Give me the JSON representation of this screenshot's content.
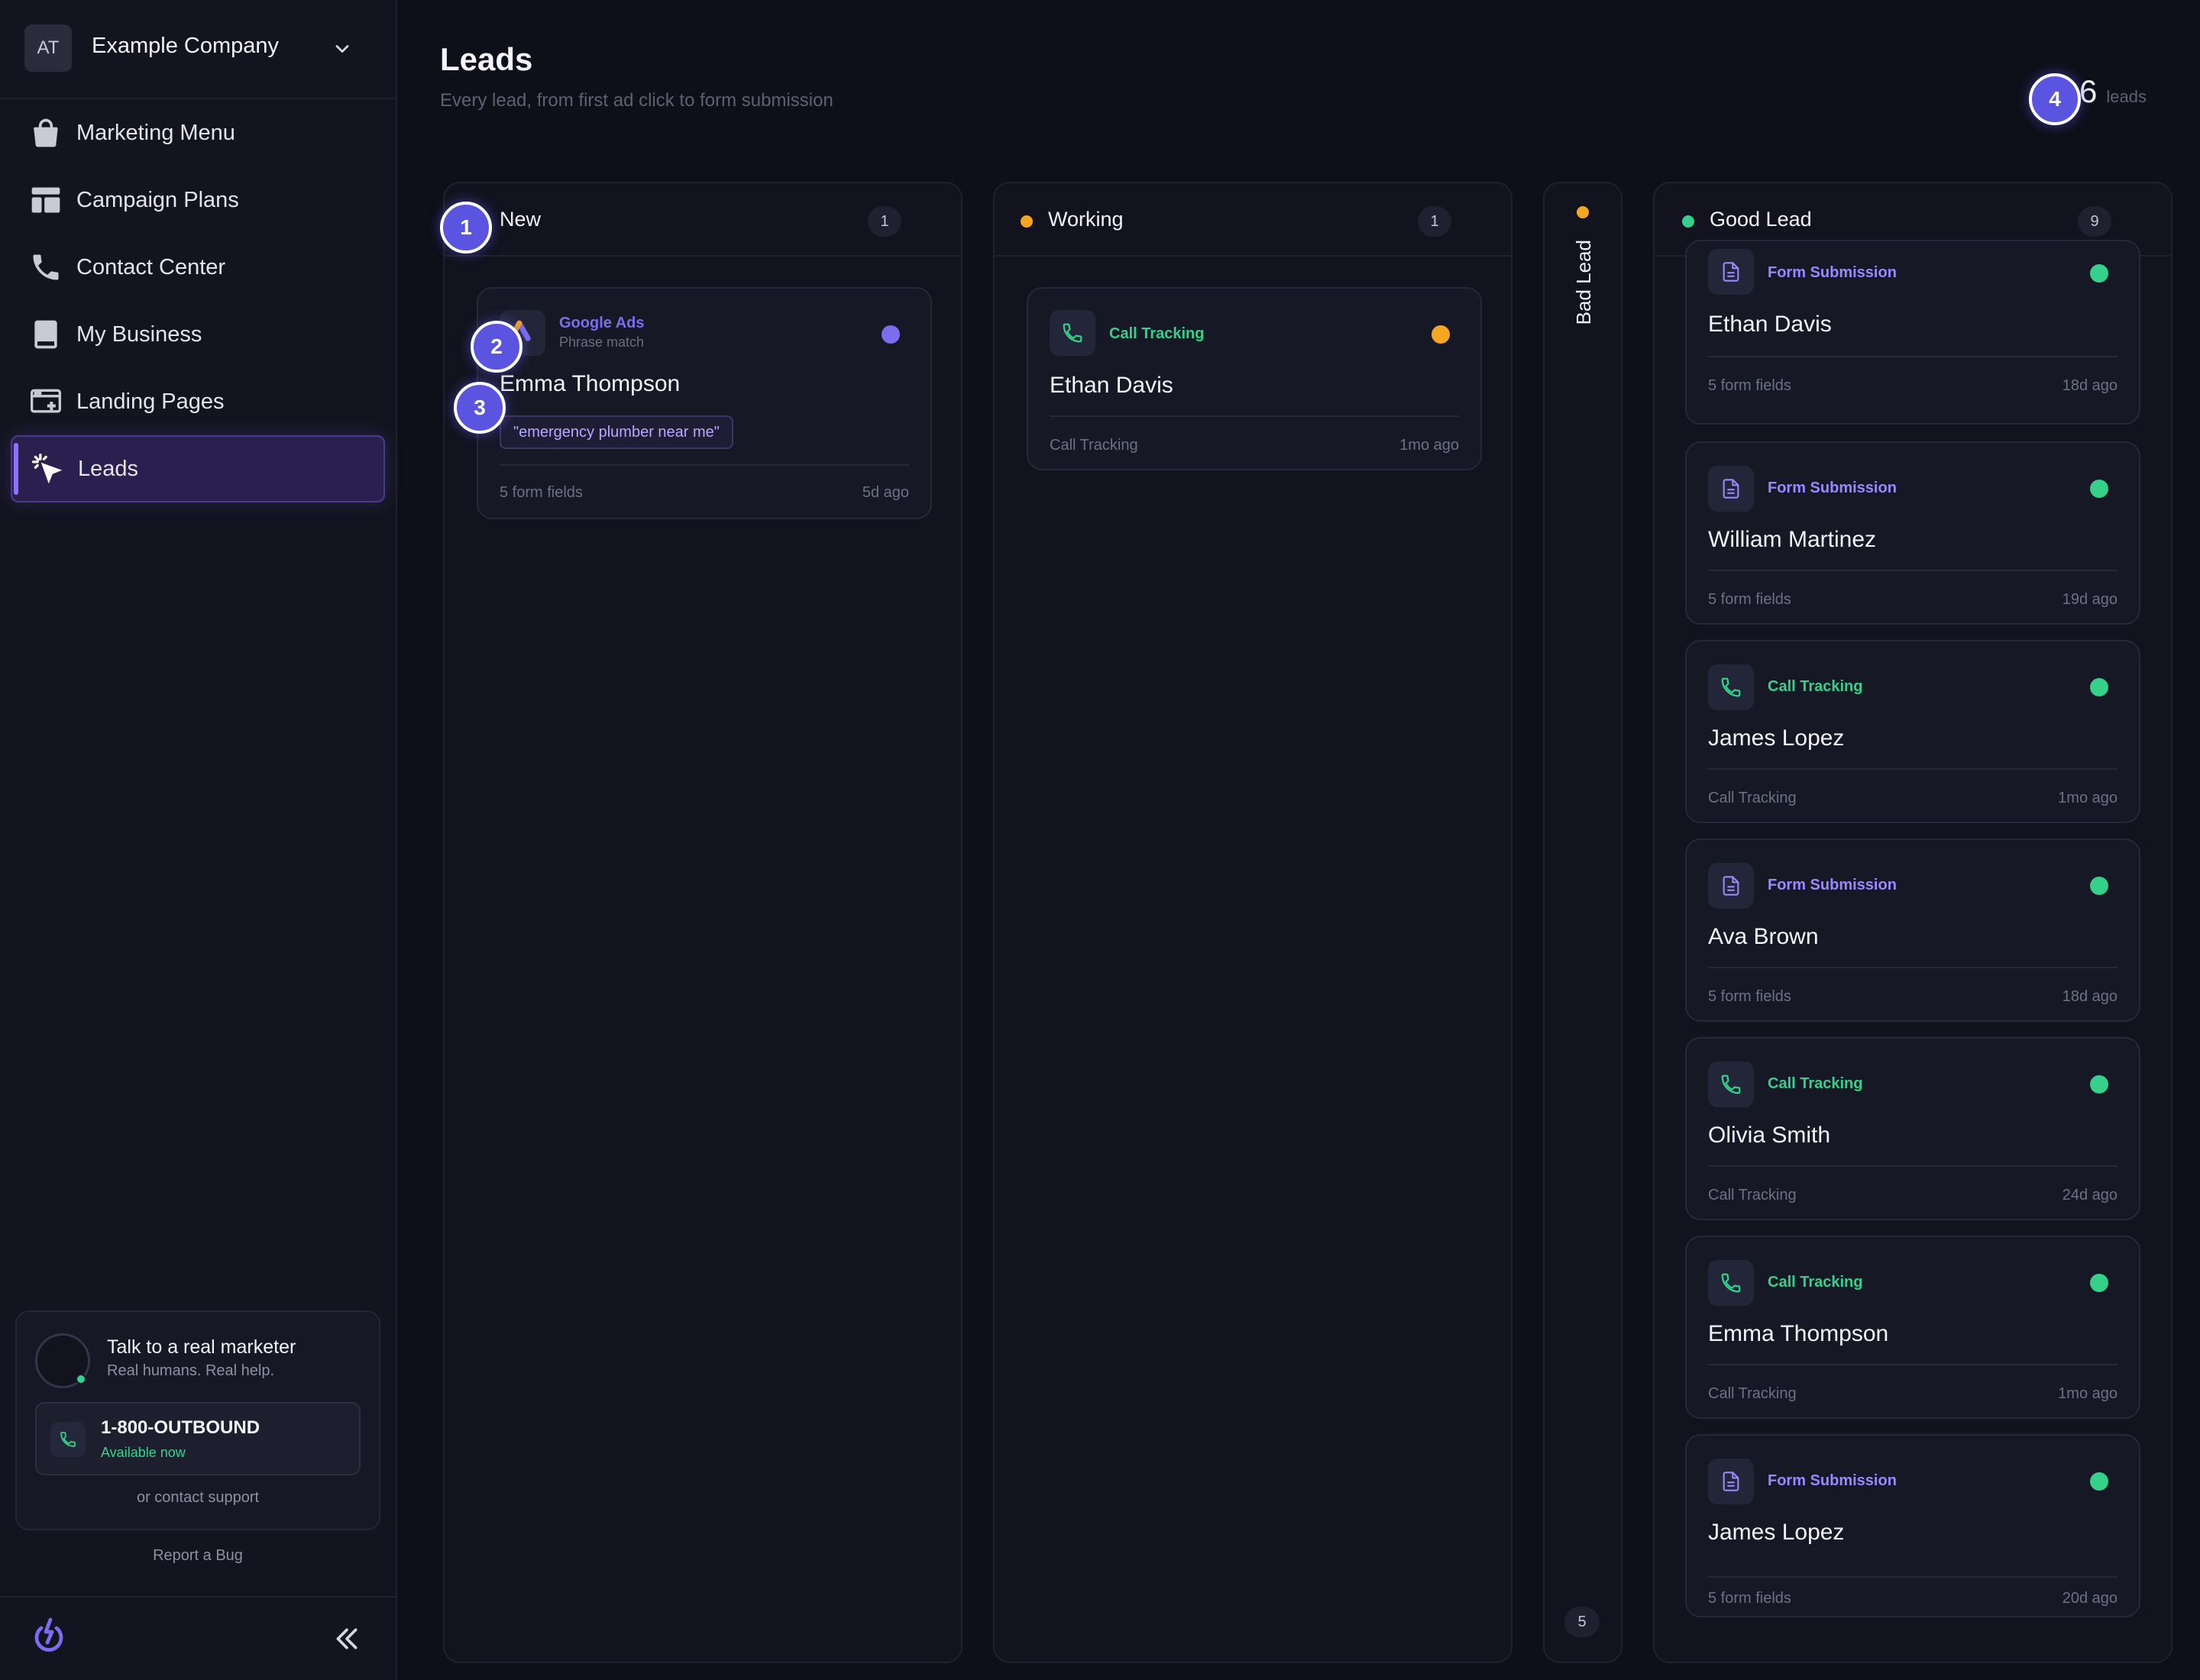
{
  "company": {
    "badge": "AT",
    "name": "Example Company"
  },
  "nav": [
    {
      "label": "Marketing Menu",
      "icon": "shopping-bag-icon"
    },
    {
      "label": "Campaign Plans",
      "icon": "layout-icon"
    },
    {
      "label": "Contact Center",
      "icon": "phone-icon"
    },
    {
      "label": "My Business",
      "icon": "book-icon"
    },
    {
      "label": "Landing Pages",
      "icon": "browser-sparkle-icon"
    },
    {
      "label": "Leads",
      "icon": "cursor-click-icon",
      "active": true
    }
  ],
  "support": {
    "title": "Talk to a real marketer",
    "subtitle": "Real humans. Real help.",
    "phone": "1-800-OUTBOUND",
    "availability": "Available now",
    "contact": "or contact support"
  },
  "report_bug": "Report a Bug",
  "page": {
    "title": "Leads",
    "subtitle": "Every lead, from first ad click to form submission",
    "count": "16",
    "count_unit": "leads"
  },
  "colors": {
    "accent": "#8b73ff",
    "working": "#f5a623",
    "good": "#35d08a",
    "call": "#35d08a",
    "form": "#9b87ff",
    "google": "#7c6cf0"
  },
  "columns": {
    "new": {
      "title": "New",
      "count": "1",
      "cards": [
        {
          "source": "Google Ads",
          "match": "Phrase match",
          "name": "Emma Thompson",
          "keyword": "\"emergency plumber near me\"",
          "fields": "5 form fields",
          "age": "5d ago"
        }
      ]
    },
    "working": {
      "title": "Working",
      "count": "1",
      "cards": [
        {
          "source": "Call Tracking",
          "name": "Ethan Davis",
          "fields": "Call Tracking",
          "age": "1mo ago"
        }
      ]
    },
    "bad": {
      "title": "Bad Lead",
      "count": "5"
    },
    "good": {
      "title": "Good Lead",
      "count": "9",
      "cards": [
        {
          "type": "form",
          "source": "Form Submission",
          "name": "Ethan Davis",
          "fields": "5 form fields",
          "age": "18d ago"
        },
        {
          "type": "form",
          "source": "Form Submission",
          "name": "William Martinez",
          "fields": "5 form fields",
          "age": "19d ago"
        },
        {
          "type": "call",
          "source": "Call Tracking",
          "name": "James Lopez",
          "fields": "Call Tracking",
          "age": "1mo ago"
        },
        {
          "type": "form",
          "source": "Form Submission",
          "name": "Ava Brown",
          "fields": "5 form fields",
          "age": "18d ago"
        },
        {
          "type": "call",
          "source": "Call Tracking",
          "name": "Olivia Smith",
          "fields": "Call Tracking",
          "age": "24d ago"
        },
        {
          "type": "call",
          "source": "Call Tracking",
          "name": "Emma Thompson",
          "fields": "Call Tracking",
          "age": "1mo ago"
        },
        {
          "type": "form",
          "source": "Form Submission",
          "name": "James Lopez",
          "fields": "5 form fields",
          "age": "20d ago"
        }
      ]
    }
  },
  "markers": [
    "1",
    "2",
    "3",
    "4"
  ]
}
